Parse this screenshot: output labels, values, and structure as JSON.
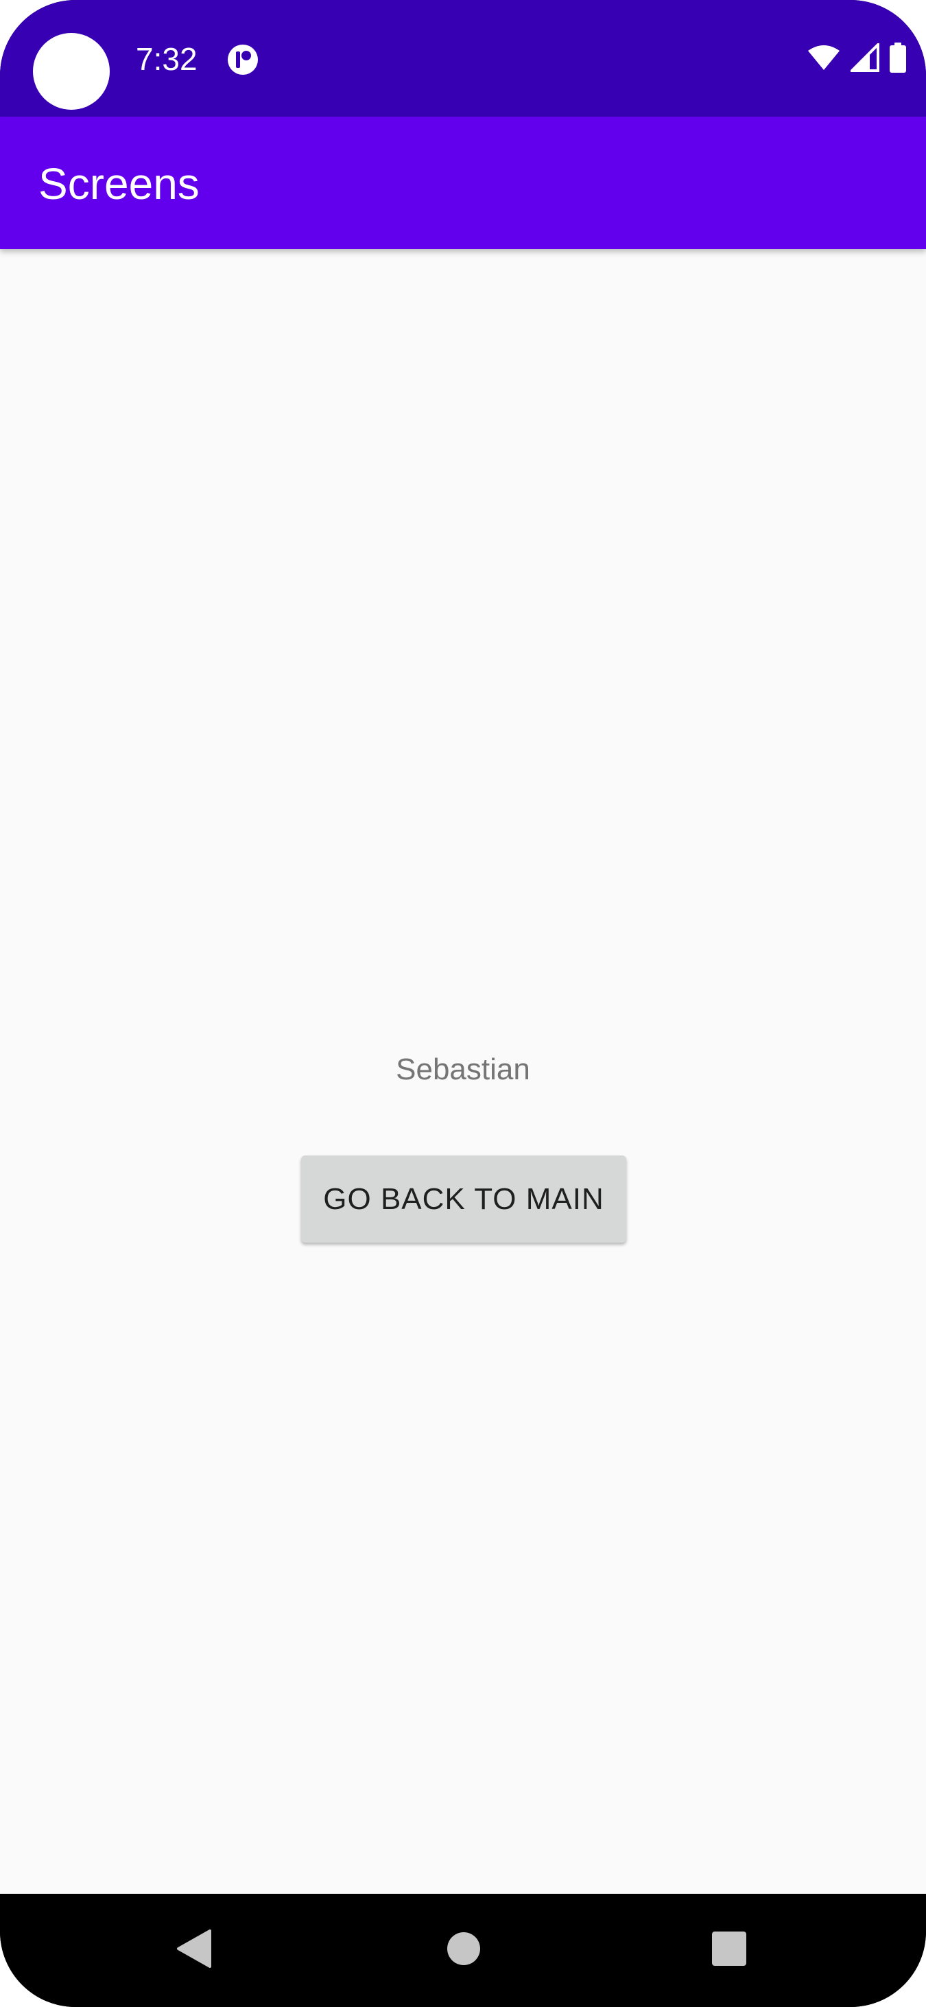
{
  "status_bar": {
    "time": "7:32",
    "icons": [
      "app-notification-icon",
      "wifi-icon",
      "cell-signal-icon",
      "battery-icon"
    ],
    "background_color": "#3700b3"
  },
  "app_bar": {
    "title": "Screens",
    "background_color": "#6200ee"
  },
  "main": {
    "name_text": "Sebastian",
    "back_button_label": "GO BACK TO MAIN"
  },
  "nav_bar": {
    "buttons": [
      "back-icon",
      "home-icon",
      "recents-icon"
    ]
  }
}
